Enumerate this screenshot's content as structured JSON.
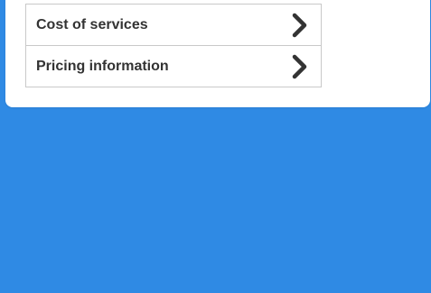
{
  "colors": {
    "background": "#2f8ae4",
    "card": "#ffffff",
    "border": "#c9c9c9",
    "text": "#333333",
    "chevron": "#333333"
  },
  "menu": {
    "items": [
      {
        "label": "Cost of services",
        "icon": "chevron-right-icon"
      },
      {
        "label": "Pricing information",
        "icon": "chevron-right-icon"
      }
    ]
  }
}
